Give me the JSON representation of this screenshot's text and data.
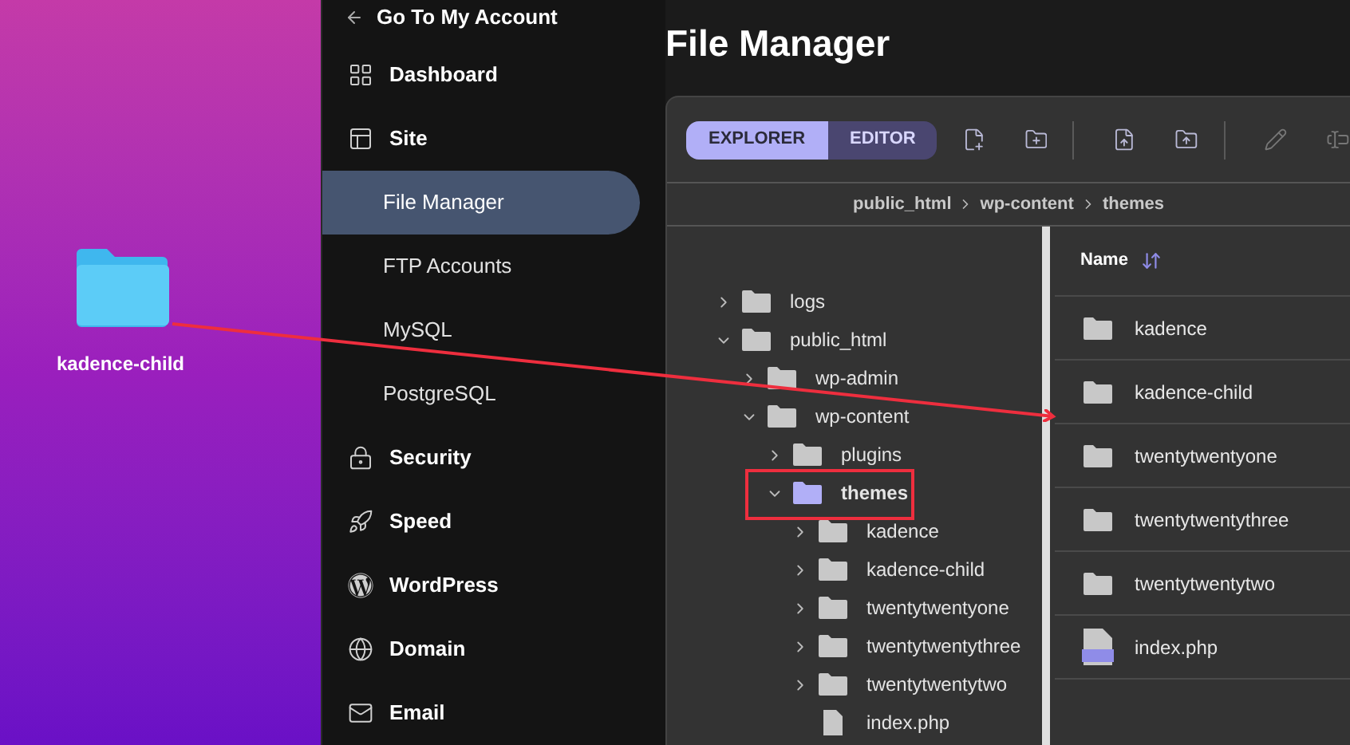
{
  "desktop": {
    "icon_label": "kadence-child"
  },
  "sidebar": {
    "back_link": "Go To My Account",
    "items": [
      {
        "label": "Dashboard",
        "kind": "section",
        "selected": false
      },
      {
        "label": "Site",
        "kind": "section",
        "selected": false
      },
      {
        "label": "File Manager",
        "kind": "sub",
        "selected": true
      },
      {
        "label": "FTP Accounts",
        "kind": "sub",
        "selected": false
      },
      {
        "label": "MySQL",
        "kind": "sub",
        "selected": false
      },
      {
        "label": "PostgreSQL",
        "kind": "sub",
        "selected": false
      },
      {
        "label": "Security",
        "kind": "section",
        "selected": false
      },
      {
        "label": "Speed",
        "kind": "section",
        "selected": false
      },
      {
        "label": "WordPress",
        "kind": "section",
        "selected": false
      },
      {
        "label": "Domain",
        "kind": "section",
        "selected": false
      },
      {
        "label": "Email",
        "kind": "section",
        "selected": false
      }
    ]
  },
  "page_title": "File Manager",
  "toolbar": {
    "tabs": [
      {
        "label": "EXPLORER",
        "selected": true
      },
      {
        "label": "EDITOR",
        "selected": false
      }
    ]
  },
  "breadcrumb": [
    "public_html",
    "wp-content",
    "themes"
  ],
  "tree": [
    {
      "name": "logs",
      "kind": "folder",
      "expanded": false,
      "selected": false
    },
    {
      "name": "public_html",
      "kind": "folder",
      "expanded": true,
      "selected": false,
      "children": [
        {
          "name": "wp-admin",
          "kind": "folder",
          "expanded": false,
          "selected": false
        },
        {
          "name": "wp-content",
          "kind": "folder",
          "expanded": true,
          "selected": false,
          "children": [
            {
              "name": "plugins",
              "kind": "folder",
              "expanded": false,
              "selected": false
            },
            {
              "name": "themes",
              "kind": "folder",
              "expanded": true,
              "selected": true,
              "children": [
                {
                  "name": "kadence",
                  "kind": "folder",
                  "expanded": false,
                  "selected": false
                },
                {
                  "name": "kadence-child",
                  "kind": "folder",
                  "expanded": false,
                  "selected": false
                },
                {
                  "name": "twentytwentyone",
                  "kind": "folder",
                  "expanded": false,
                  "selected": false
                },
                {
                  "name": "twentytwentythree",
                  "kind": "folder",
                  "expanded": false,
                  "selected": false
                },
                {
                  "name": "twentytwentytwo",
                  "kind": "folder",
                  "expanded": false,
                  "selected": false
                },
                {
                  "name": "index.php",
                  "kind": "file",
                  "selected": false
                }
              ]
            }
          ]
        }
      ]
    }
  ],
  "file_list": {
    "column": "Name",
    "rows": [
      {
        "name": "kadence",
        "kind": "folder"
      },
      {
        "name": "kadence-child",
        "kind": "folder"
      },
      {
        "name": "twentytwentyone",
        "kind": "folder"
      },
      {
        "name": "twentytwentythree",
        "kind": "folder"
      },
      {
        "name": "twentytwentytwo",
        "kind": "folder"
      },
      {
        "name": "index.php",
        "kind": "php"
      }
    ]
  }
}
